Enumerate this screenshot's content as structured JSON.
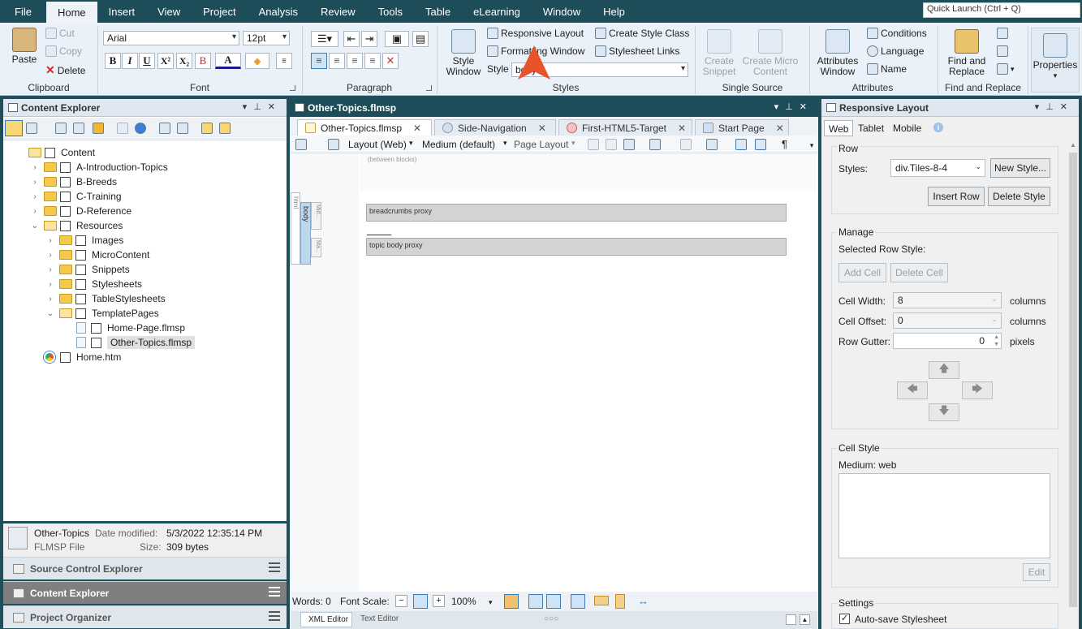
{
  "menu": {
    "tabs": [
      "File",
      "Home",
      "Insert",
      "View",
      "Project",
      "Analysis",
      "Review",
      "Tools",
      "Table",
      "eLearning",
      "Window",
      "Help"
    ],
    "active": "Home",
    "quick_launch_placeholder": "Quick Launch (Ctrl + Q)"
  },
  "ribbon": {
    "clipboard": {
      "label": "Clipboard",
      "paste": "Paste",
      "cut": "Cut",
      "copy": "Copy",
      "delete": "Delete"
    },
    "font": {
      "label": "Font",
      "family": "Arial",
      "size": "12pt",
      "bold": "B",
      "italic": "I",
      "underline": "U",
      "superscript": "X²",
      "subscript": "X₂",
      "clear": "B",
      "color": "A"
    },
    "paragraph": {
      "label": "Paragraph"
    },
    "styles": {
      "label": "Styles",
      "style_window": "Style\nWindow",
      "style_window_l1": "Style",
      "style_window_l2": "Window",
      "responsive_layout": "Responsive Layout",
      "formatting_window": "Formatting Window",
      "create_style_class": "Create Style Class",
      "stylesheet_links": "Stylesheet Links",
      "style_label": "Style",
      "style_value": "body"
    },
    "single_source": {
      "label": "Single Source",
      "create_snippet_l1": "Create",
      "create_snippet_l2": "Snippet",
      "create_micro_l1": "Create Micro",
      "create_micro_l2": "Content"
    },
    "attributes": {
      "label": "Attributes",
      "attributes_window_l1": "Attributes",
      "attributes_window_l2": "Window",
      "conditions": "Conditions",
      "language": "Language",
      "name": "Name"
    },
    "find_replace": {
      "label": "Find and Replace",
      "find_l1": "Find and",
      "find_l2": "Replace"
    },
    "properties": {
      "label": "Properties"
    }
  },
  "content_explorer": {
    "title": "Content Explorer",
    "tree": [
      {
        "label": "Content",
        "depth": 0,
        "type": "folder-open",
        "twisty": ""
      },
      {
        "label": "A-Introduction-Topics",
        "depth": 1,
        "type": "folder",
        "twisty": "›"
      },
      {
        "label": "B-Breeds",
        "depth": 1,
        "type": "folder",
        "twisty": "›"
      },
      {
        "label": "C-Training",
        "depth": 1,
        "type": "folder",
        "twisty": "›"
      },
      {
        "label": "D-Reference",
        "depth": 1,
        "type": "folder",
        "twisty": "›"
      },
      {
        "label": "Resources",
        "depth": 1,
        "type": "folder-open",
        "twisty": "⌄"
      },
      {
        "label": "Images",
        "depth": 2,
        "type": "folder",
        "twisty": "›"
      },
      {
        "label": "MicroContent",
        "depth": 2,
        "type": "folder",
        "twisty": "›"
      },
      {
        "label": "Snippets",
        "depth": 2,
        "type": "folder",
        "twisty": "›"
      },
      {
        "label": "Stylesheets",
        "depth": 2,
        "type": "folder",
        "twisty": "›"
      },
      {
        "label": "TableStylesheets",
        "depth": 2,
        "type": "folder",
        "twisty": "›"
      },
      {
        "label": "TemplatePages",
        "depth": 2,
        "type": "folder-open",
        "twisty": "⌄"
      },
      {
        "label": "Home-Page.flmsp",
        "depth": 3,
        "type": "file",
        "twisty": ""
      },
      {
        "label": "Other-Topics.flmsp",
        "depth": 3,
        "type": "file",
        "twisty": "",
        "selected": true
      },
      {
        "label": "Home.htm",
        "depth": 1,
        "type": "globe",
        "twisty": ""
      }
    ],
    "file_info": {
      "name": "Other-Topics",
      "date_label": "Date modified:",
      "date": "5/3/2022 12:35:14 PM",
      "type": "FLMSP File",
      "size_label": "Size:",
      "size": "309 bytes"
    }
  },
  "dock_tabs": [
    "Source Control Explorer",
    "Content Explorer",
    "Project Organizer"
  ],
  "editor": {
    "title": "Other-Topics.flmsp",
    "tabs": [
      "Other-Topics.flmsp",
      "Side-Navigation",
      "First-HTML5-Target",
      "Start Page"
    ],
    "toolbar": {
      "layout": "Layout (Web)",
      "medium": "Medium (default)",
      "page_layout": "Page Layout",
      "pilcrow": "¶"
    },
    "between_blocks": "(between blocks)",
    "html_tag": "html",
    "body_tag": "body",
    "mid_tag": "Mid...",
    "ma_tag": "Ma...",
    "breadcrumbs": "breadcrumbs proxy",
    "topic_body": "topic body proxy",
    "status": {
      "words": "Words: 0",
      "font_scale": "Font Scale:",
      "zoom": "100%"
    },
    "bottom_tabs": [
      "XML Editor",
      "Text Editor"
    ]
  },
  "responsive_layout": {
    "title": "Responsive Layout",
    "tabs": [
      "Web",
      "Tablet",
      "Mobile"
    ],
    "row": {
      "legend": "Row",
      "styles_label": "Styles:",
      "styles_value": "div.Tiles-8-4",
      "new_style": "New Style...",
      "insert_row": "Insert Row",
      "delete_style": "Delete Style"
    },
    "manage": {
      "legend": "Manage",
      "selected": "Selected Row Style:",
      "add_cell": "Add Cell",
      "delete_cell": "Delete Cell",
      "cell_width_label": "Cell Width:",
      "cell_width": "8",
      "cell_width_unit": "columns",
      "cell_offset_label": "Cell Offset:",
      "cell_offset": "0",
      "cell_offset_unit": "columns",
      "row_gutter_label": "Row Gutter:",
      "row_gutter": "0",
      "row_gutter_unit": "pixels"
    },
    "cell_style": {
      "legend": "Cell Style",
      "medium": "Medium: web",
      "edit": "Edit"
    },
    "settings": {
      "legend": "Settings",
      "autosave": "Auto-save Stylesheet"
    }
  },
  "colors": {
    "titlebar": "#1d4d58",
    "ribbon": "#eaf1f8",
    "callout": "#e8542a",
    "proxy": "#d3d3d3"
  }
}
